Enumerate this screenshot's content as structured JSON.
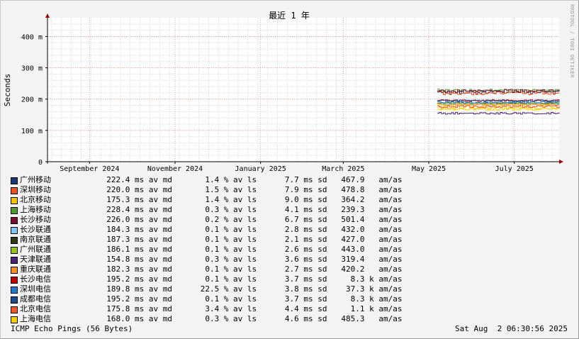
{
  "chart_data": {
    "type": "line",
    "title": "最近 1 年",
    "ylabel": "Seconds",
    "watermark": "RRDTOOL / TOBI OETIKER",
    "ylim": [
      0,
      460
    ],
    "y_ticks": [
      {
        "value": 0,
        "label": "0"
      },
      {
        "value": 100,
        "label": "100 m"
      },
      {
        "value": 200,
        "label": "200 m"
      },
      {
        "value": 300,
        "label": "300 m"
      },
      {
        "value": 400,
        "label": "400 m"
      }
    ],
    "x_range": [
      "2024-08-02",
      "2025-08-02"
    ],
    "x_ticks": [
      {
        "date": "2024-09-01",
        "label": "September 2024"
      },
      {
        "date": "2024-11-01",
        "label": "November 2024"
      },
      {
        "date": "2025-01-01",
        "label": "January 2025"
      },
      {
        "date": "2025-03-01",
        "label": "March 2025"
      },
      {
        "date": "2025-05-01",
        "label": "May 2025"
      },
      {
        "date": "2025-07-01",
        "label": "July 2025"
      }
    ],
    "data_start": "2025-05-07",
    "data_end": "2025-08-02",
    "grid": true,
    "legend_position": "bottom",
    "series": [
      {
        "name": "广州移动",
        "color": "#1a3a73",
        "avg": "222.4 ms av md",
        "loss": "1.4 % av ls",
        "sd": "7.7 ms sd",
        "ratio": "467.9   am/as",
        "level": 222.4,
        "sdv": 7.7
      },
      {
        "name": "深圳移动",
        "color": "#e8541c",
        "avg": "220.0 ms av md",
        "loss": "1.5 % av ls",
        "sd": "7.9 ms sd",
        "ratio": "478.8   am/as",
        "level": 220.0,
        "sdv": 7.9
      },
      {
        "name": "北京移动",
        "color": "#f5c400",
        "avg": "175.3 ms av md",
        "loss": "1.4 % av ls",
        "sd": "9.0 ms sd",
        "ratio": "364.2   am/as",
        "level": 175.3,
        "sdv": 9.0
      },
      {
        "name": "上海移动",
        "color": "#4c9a2a",
        "avg": "228.4 ms av md",
        "loss": "0.3 % av ls",
        "sd": "4.1 ms sd",
        "ratio": "239.3   am/as",
        "level": 228.4,
        "sdv": 4.1
      },
      {
        "name": "长沙移动",
        "color": "#7a0c2e",
        "avg": "226.0 ms av md",
        "loss": "0.2 % av ls",
        "sd": "6.7 ms sd",
        "ratio": "501.4   am/as",
        "level": 226.0,
        "sdv": 6.7
      },
      {
        "name": "长沙联通",
        "color": "#7fc7f0",
        "avg": "184.3 ms av md",
        "loss": "0.1 % av ls",
        "sd": "2.8 ms sd",
        "ratio": "432.0   am/as",
        "level": 184.3,
        "sdv": 2.8
      },
      {
        "name": "南京联通",
        "color": "#2e3a12",
        "avg": "187.3 ms av md",
        "loss": "0.1 % av ls",
        "sd": "2.1 ms sd",
        "ratio": "427.0   am/as",
        "level": 187.3,
        "sdv": 2.1
      },
      {
        "name": "广州联通",
        "color": "#9ac21c",
        "avg": "186.1 ms av md",
        "loss": "0.1 % av ls",
        "sd": "2.6 ms sd",
        "ratio": "443.0   am/as",
        "level": 186.1,
        "sdv": 2.6
      },
      {
        "name": "天津联通",
        "color": "#4a2373",
        "avg": "154.8 ms av md",
        "loss": "0.3 % av ls",
        "sd": "3.6 ms sd",
        "ratio": "319.4   am/as",
        "level": 154.8,
        "sdv": 3.6
      },
      {
        "name": "重庆联通",
        "color": "#f5931e",
        "avg": "182.3 ms av md",
        "loss": "0.1 % av ls",
        "sd": "2.7 ms sd",
        "ratio": "420.2   am/as",
        "level": 182.3,
        "sdv": 2.7
      },
      {
        "name": "长沙电信",
        "color": "#c00000",
        "avg": "195.2 ms av md",
        "loss": "0.1 % av ls",
        "sd": "3.7 ms sd",
        "ratio": "8.3 k am/as",
        "level": 195.2,
        "sdv": 3.7
      },
      {
        "name": "深圳电信",
        "color": "#1f78c8",
        "avg": "189.8 ms av md",
        "loss": "22.5 % av ls",
        "sd": "3.8 ms sd",
        "ratio": "37.3 k am/as",
        "level": 189.8,
        "sdv": 3.8
      },
      {
        "name": "成都电信",
        "color": "#1a4d8c",
        "avg": "195.2 ms av md",
        "loss": "0.1 % av ls",
        "sd": "3.7 ms sd",
        "ratio": "8.3 k am/as",
        "level": 195.2,
        "sdv": 3.7
      },
      {
        "name": "北京电信",
        "color": "#f05a22",
        "avg": "175.8 ms av md",
        "loss": "3.4 % av ls",
        "sd": "4.4 ms sd",
        "ratio": "1.1 k am/as",
        "level": 175.8,
        "sdv": 4.4
      },
      {
        "name": "上海电信",
        "color": "#f5d000",
        "avg": "168.0 ms av md",
        "loss": "0.3 % av ls",
        "sd": "4.6 ms sd",
        "ratio": "485.3   am/as",
        "level": 168.0,
        "sdv": 4.6
      }
    ]
  },
  "footer": {
    "left": "ICMP Echo Pings (56 Bytes)",
    "right": "Sat Aug  2 06:30:56 2025"
  }
}
